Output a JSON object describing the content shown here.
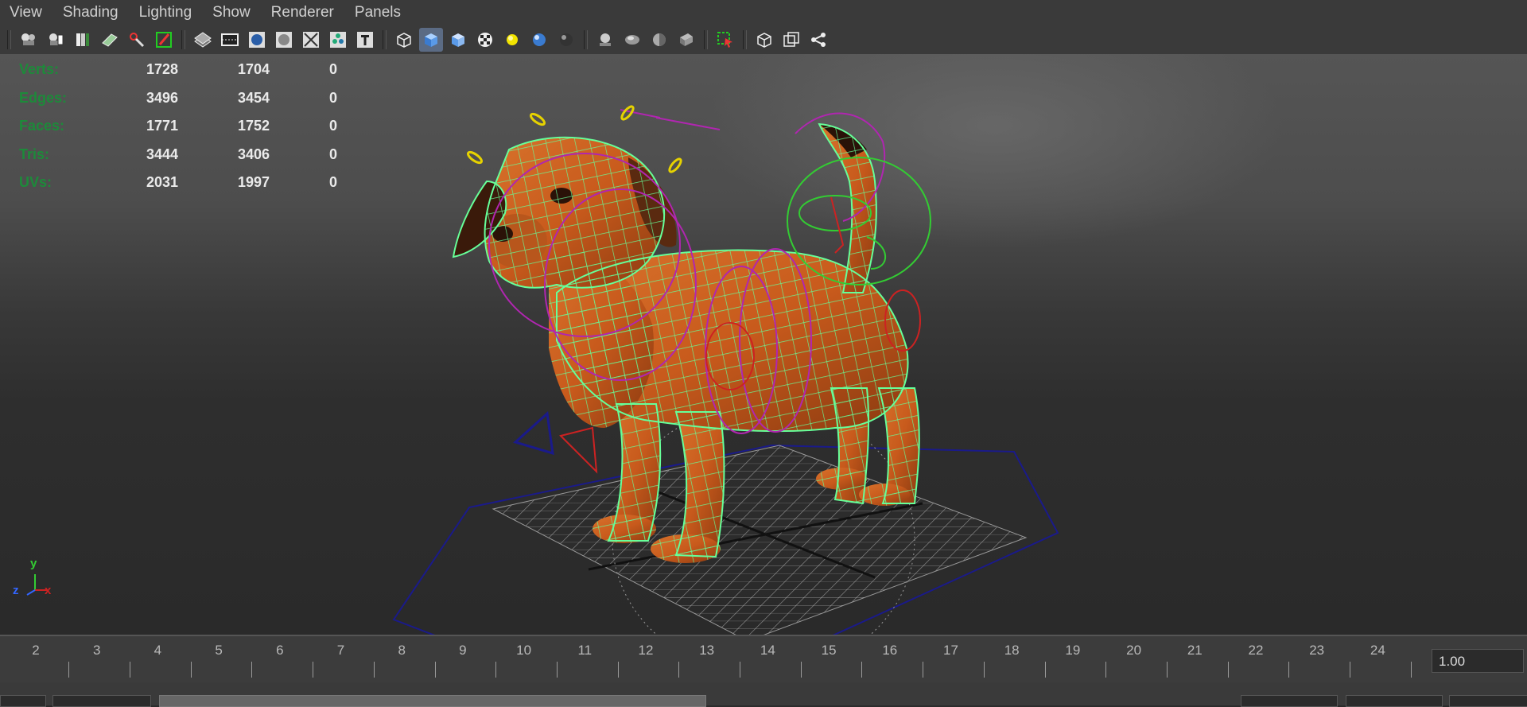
{
  "menubar": {
    "items": [
      "View",
      "Shading",
      "Lighting",
      "Show",
      "Renderer",
      "Panels"
    ]
  },
  "toolbar": {
    "icons": [
      "camera-select-icon",
      "camera-attributes-icon",
      "bookmarks-icon",
      "image-plane-icon",
      "grease-pencil-icon",
      "film-gate-icon",
      "grid-icon",
      "resolution-gate-icon",
      "shading-sphere-icon",
      "wireframe-on-shaded-icon",
      "xray-icon",
      "xray-joints-icon",
      "text-icon",
      "wireframe-cube-icon",
      "smooth-shade-cube-icon",
      "default-material-cube-icon",
      "textured-icon",
      "lights-icon",
      "shadows-icon",
      "ambient-occlusion-icon",
      "motion-blur-icon",
      "anti-aliasing-icon",
      "depth-of-field-icon",
      "hardware-fog-icon",
      "isolate-select-icon",
      "single-pane-icon",
      "two-pane-icon",
      "hypergraph-icon"
    ]
  },
  "hud": {
    "rows": [
      {
        "label": "Verts:",
        "v1": "1728",
        "v2": "1704",
        "v3": "0"
      },
      {
        "label": "Edges:",
        "v1": "3496",
        "v2": "3454",
        "v3": "0"
      },
      {
        "label": "Faces:",
        "v1": "1771",
        "v2": "1752",
        "v3": "0"
      },
      {
        "label": "Tris:",
        "v1": "3444",
        "v2": "3406",
        "v3": "0"
      },
      {
        "label": "UVs:",
        "v1": "2031",
        "v2": "1997",
        "v3": "0"
      }
    ]
  },
  "axis": {
    "y": "y",
    "z": "z",
    "x": "x"
  },
  "timeline": {
    "frames": [
      "2",
      "3",
      "4",
      "5",
      "6",
      "7",
      "8",
      "9",
      "10",
      "11",
      "12",
      "13",
      "14",
      "15",
      "16",
      "17",
      "18",
      "19",
      "20",
      "21",
      "22",
      "23",
      "24"
    ],
    "current_frame": "1.00"
  },
  "colors": {
    "hud_label": "#1d8a3a",
    "wireframe": "#66ff99",
    "dog_body": "#c85a1c",
    "control_magenta": "#b026b0",
    "control_green": "#33cc33",
    "control_yellow": "#e6d200",
    "control_blue": "#1a1a8a",
    "control_red": "#cc2222"
  }
}
